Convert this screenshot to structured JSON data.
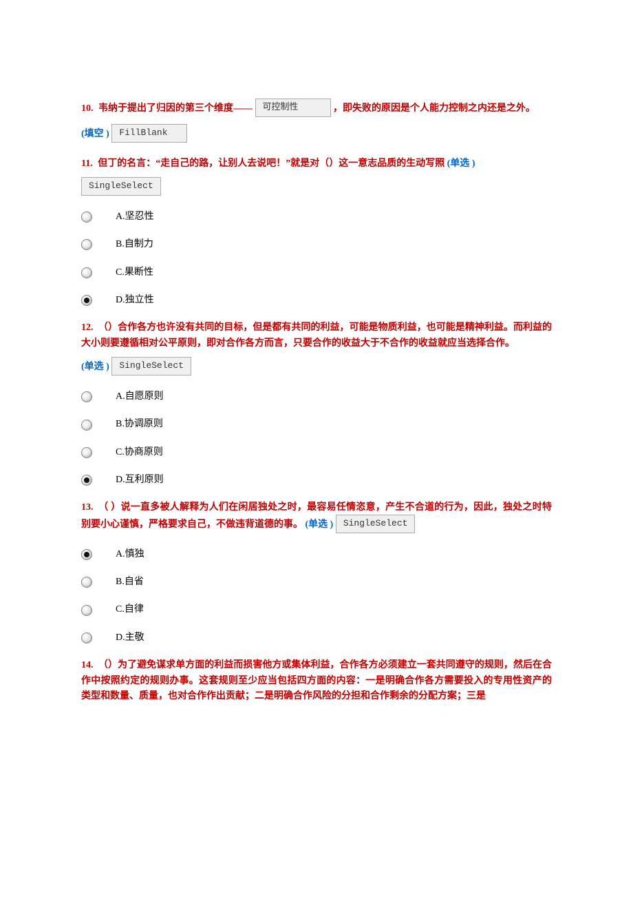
{
  "q10": {
    "num": "10.",
    "pre": "韦纳于提出了归因的第三个维度——",
    "box": "可控制性",
    "post": "，即失败的原因是个人能力控制之内还是之外。",
    "marker": "(填空  )",
    "typebox": "FillBlank"
  },
  "q11": {
    "num": "11.",
    "text": "但丁的名言：“走自己的路，让别人去说吧！”就是对（）这一意志品质的生动写照",
    "marker": "(单选  )",
    "typebox": "SingleSelect",
    "opts": [
      {
        "k": "A.",
        "v": "坚忍性",
        "checked": false
      },
      {
        "k": "B.",
        "v": "自制力",
        "checked": false
      },
      {
        "k": "C.",
        "v": "果断性",
        "checked": false
      },
      {
        "k": "D.",
        "v": "独立性",
        "checked": true
      }
    ]
  },
  "q12": {
    "num": "12.",
    "text": "（）合作各方也许没有共同的目标，但是都有共同的利益，可能是物质利益，也可能是精神利益。而利益的大小则要遵循相对公平原则，即对合作各方而言，只要合作的收益大于不合作的收益就应当选择合作。",
    "marker": "(单选  )",
    "typebox": "SingleSelect",
    "opts": [
      {
        "k": "A.",
        "v": "自愿原则",
        "checked": false
      },
      {
        "k": "B.",
        "v": "协调原则",
        "checked": false
      },
      {
        "k": "C.",
        "v": "协商原则",
        "checked": false
      },
      {
        "k": "D.",
        "v": "互利原则",
        "checked": true
      }
    ]
  },
  "q13": {
    "num": "13.",
    "text": "（ ）说一直多被人解释为人们在闲居独处之时，最容易任情恣意，产生不合道的行为，因此，独处之时特别要小心谨慎，严格要求自己，不做违背道德的事。",
    "marker": "(单选  )",
    "typebox": "SingleSelect",
    "opts": [
      {
        "k": "A.",
        "v": "慎独",
        "checked": true
      },
      {
        "k": "B.",
        "v": "自省",
        "checked": false
      },
      {
        "k": "C.",
        "v": "自律",
        "checked": false
      },
      {
        "k": "D.",
        "v": "主敬",
        "checked": false
      }
    ]
  },
  "q14": {
    "num": "14.",
    "text": "（）为了避免谋求单方面的利益而损害他方或集体利益，合作各方必须建立一套共同遵守的规则，然后在合作中按照约定的规则办事。这套规则至少应当包括四方面的内容：一是明确合作各方需要投入的专用性资产的类型和数量、质量，也对合作作出贡献；二是明确合作风险的分担和合作剩余的分配方案；三是"
  }
}
